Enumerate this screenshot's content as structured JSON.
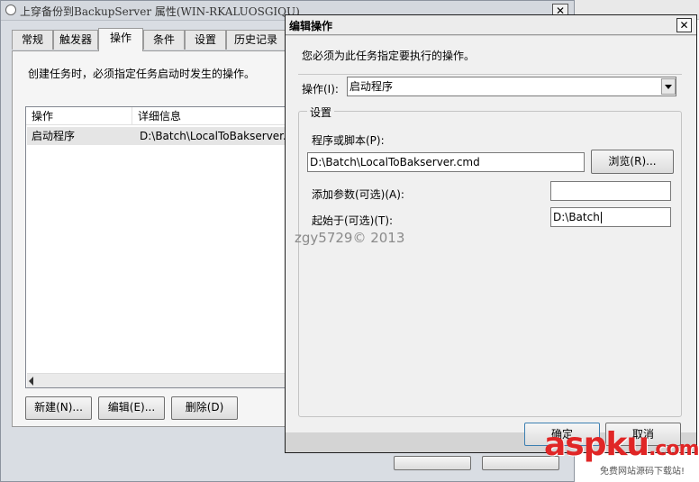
{
  "background_window": {
    "title": "上穿备份到BackupServer 属性(WIN-RKALUOSGIQU)",
    "close_glyph": "✕",
    "tabs": [
      {
        "label": "常规"
      },
      {
        "label": "触发器"
      },
      {
        "label": "操作",
        "active": true
      },
      {
        "label": "条件"
      },
      {
        "label": "设置"
      },
      {
        "label": "历史记录"
      }
    ],
    "description": "创建任务时，必须指定任务启动时发生的操作。",
    "list": {
      "columns": [
        "操作",
        "详细信息"
      ],
      "rows": [
        {
          "action": "启动程序",
          "details": "D:\\Batch\\LocalToBakserver.cmd"
        }
      ]
    },
    "buttons": {
      "new": "新建(N)...",
      "edit": "编辑(E)...",
      "delete": "删除(D)"
    }
  },
  "dialog": {
    "title": "编辑操作",
    "close_glyph": "✕",
    "description": "您必须为此任务指定要执行的操作。",
    "action_label": "操作(I):",
    "action_value": "启动程序",
    "group_title": "设置",
    "program_label": "程序或脚本(P):",
    "program_value": "D:\\Batch\\LocalToBakserver.cmd",
    "browse_button": "浏览(R)...",
    "arguments_label": "添加参数(可选)(A):",
    "arguments_value": "",
    "start_in_label": "起始于(可选)(T):",
    "start_in_value": "D:\\Batch",
    "ok_button": "确定",
    "cancel_button": "取消"
  },
  "watermarks": {
    "copyright": "zgy5729© 2013",
    "logo": "aspku",
    "logo_suffix": ".com",
    "logo_sub": "免费网站源码下载站!"
  },
  "colors": {
    "window_bg": "#d9dde3",
    "panel_bg": "#f0f0f0",
    "selected_row": "#e5e5e5",
    "logo_red": "#e02626"
  }
}
